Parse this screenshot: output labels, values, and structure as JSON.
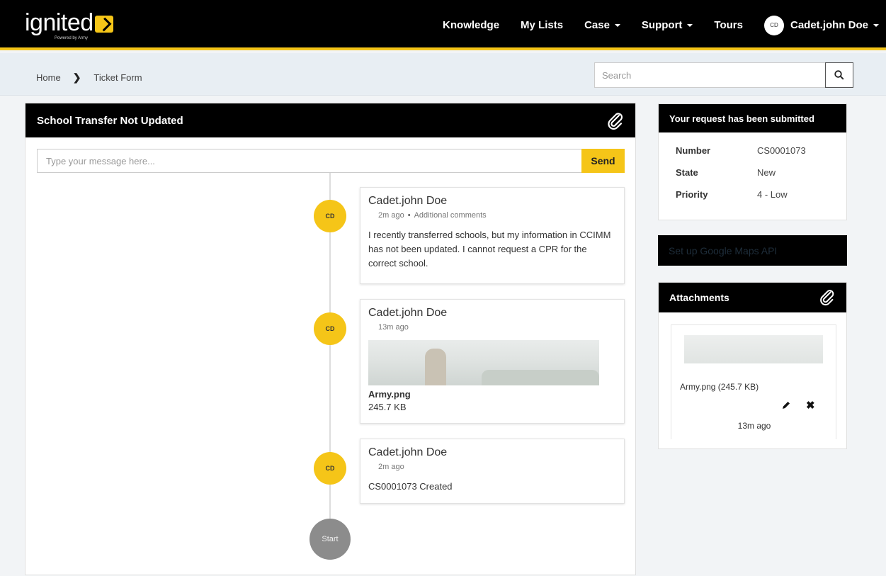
{
  "brand": {
    "logo": "ignited",
    "sub": "Powered by Army"
  },
  "nav": {
    "items": [
      {
        "label": "Knowledge",
        "caret": false
      },
      {
        "label": "My Lists",
        "caret": false
      },
      {
        "label": "Case",
        "caret": true
      },
      {
        "label": "Support",
        "caret": true
      },
      {
        "label": "Tours",
        "caret": false
      }
    ],
    "user": {
      "initials": "CD",
      "name": "Cadet.john Doe"
    }
  },
  "breadcrumb": {
    "home": "Home",
    "current": "Ticket Form"
  },
  "search": {
    "placeholder": "Search"
  },
  "ticket": {
    "title": "School Transfer Not Updated",
    "message_placeholder": "Type your message here...",
    "send_label": "Send",
    "start_label": "Start",
    "entries": [
      {
        "initials": "CD",
        "author": "Cadet.john Doe",
        "time": "2m ago",
        "type": "Additional comments",
        "body": "I recently transferred schools, but my information in CCIMM has not been updated. I cannot request a CPR for the correct school."
      },
      {
        "initials": "CD",
        "author": "Cadet.john Doe",
        "time": "13m ago",
        "file_name": "Army.png",
        "file_size": "245.7 KB"
      },
      {
        "initials": "CD",
        "author": "Cadet.john Doe",
        "time": "2m ago",
        "body": "CS0001073 Created"
      }
    ]
  },
  "summary": {
    "title": "Your request has been submitted",
    "rows": [
      {
        "key": "Number",
        "value": "CS0001073"
      },
      {
        "key": "State",
        "value": "New"
      },
      {
        "key": "Priority",
        "value": "4 - Low"
      }
    ]
  },
  "maps": {
    "label": "Set up Google Maps API"
  },
  "attachments": {
    "title": "Attachments",
    "file": "Army.png (245.7 KB)",
    "time": "13m ago"
  },
  "colors": {
    "accent": "#f5c518",
    "header": "#000000",
    "start": "#8c8c8c"
  }
}
